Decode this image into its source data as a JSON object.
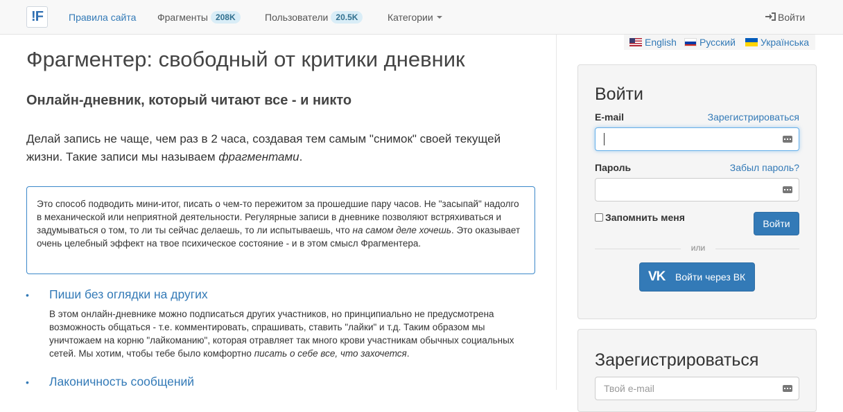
{
  "navbar": {
    "logo_text": "!F",
    "rules_label": "Правила сайта",
    "fragments_label": "Фрагменты",
    "fragments_count": "208K",
    "users_label": "Пользователи",
    "users_count": "20.5K",
    "categories_label": "Категории",
    "login_label": "Войти"
  },
  "languages": [
    {
      "label": "English",
      "flag": "us"
    },
    {
      "label": "Русский",
      "flag": "ru"
    },
    {
      "label": "Українська",
      "flag": "ua"
    }
  ],
  "main": {
    "title": "Фрагментер: свободный от критики дневник",
    "subtitle": "Онлайн-дневник, который читают все - и никто",
    "lead_text": "Делай запись не чаще, чем раз в 2 часа, создавая тем самым \"снимок\" своей текущей жизни. Такие записи мы называем ",
    "lead_em": "фрагментами",
    "lead_end": ".",
    "box_text": "Это способ подводить мини-итог, писать о чем-то пережитом за прошедшие пару часов. Не \"засыпай\" надолго в механической или неприятной деятельности. Регулярные записи в дневнике позволяют встряхиваться и задумываться о том, то ли ты сейчас делаешь, то ли испытываешь, что ",
    "box_em": "на самом деле хочешь",
    "box_end": ". Это оказывает очень целебный эффект на твое психическое состояние - и в этом смысл Фрагментера.",
    "features": [
      {
        "title": "Пиши без оглядки на других",
        "text": "В этом онлайн-дневнике можно подписаться других участников, но принципиально не предусмотрена возможность общаться - т.е. комментировать, спрашивать, ставить \"лайки\" и т.д. Таким образом мы уничтожаем на корню \"лайкоманию\", которая отравляет так много крови участникам обычных социальных сетей. Мы хотим, чтобы тебе было комфортно ",
        "em": "писать о себе все, что захочется",
        "end": "."
      },
      {
        "title": "Лаконичность сообщений"
      }
    ]
  },
  "login": {
    "title": "Войти",
    "email_label": "E-mail",
    "register_link": "Зарегистрироваться",
    "password_label": "Пароль",
    "forgot_link": "Забыл пароль?",
    "remember_label": "Запомнить меня",
    "submit_label": "Войти",
    "or_text": "или",
    "vk_label": "Войти через ВК",
    "vk_icon_text": "VK"
  },
  "register": {
    "title": "Зарегистрироваться",
    "email_placeholder": "Твой e-mail"
  }
}
